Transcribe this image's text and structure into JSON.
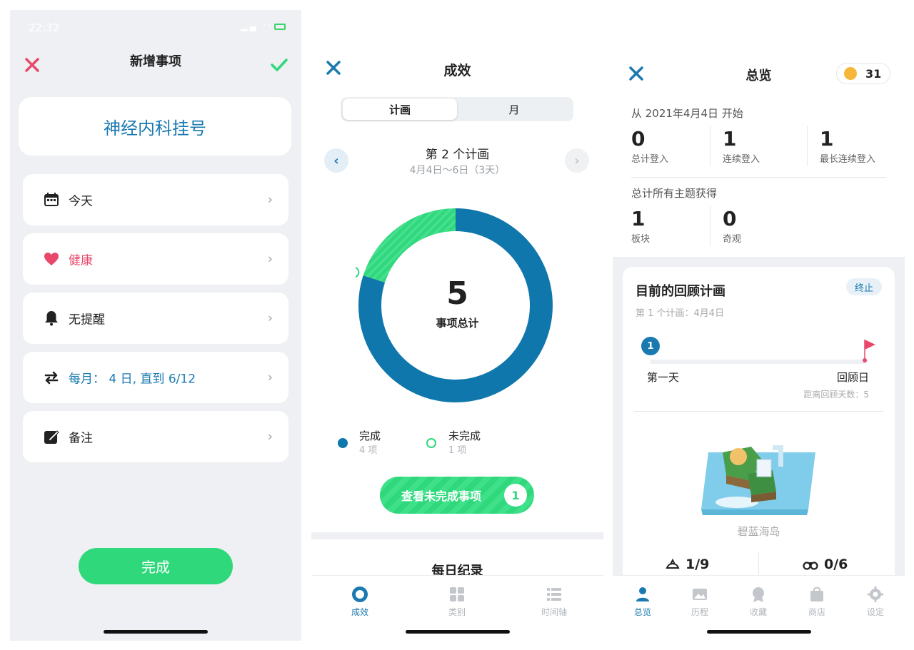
{
  "new_item": {
    "status_time": "22:32",
    "title": "新增事项",
    "name": "神经内科挂号",
    "rows": [
      {
        "label": "今天",
        "color": "#222222"
      },
      {
        "label": "健康",
        "color": "#e8486a"
      },
      {
        "label": "无提醒",
        "color": "#222222"
      },
      {
        "label": "每月： 4 日, 直到 6/12",
        "color": "#1a7ab0"
      },
      {
        "label": "备注",
        "color": "#222222"
      }
    ],
    "done_button": "完成"
  },
  "results": {
    "title": "成效",
    "segments": [
      "计画",
      "月"
    ],
    "plan_title": "第 2 个计画",
    "plan_range": "4月4日～6日（3天）",
    "total": "5",
    "total_label": "事项总计",
    "legend": [
      {
        "label": "完成",
        "sub": "4 项",
        "color": "#0f77ac"
      },
      {
        "label": "未完成",
        "sub": "1 项",
        "color": "#2fd87a"
      }
    ],
    "view_button": "查看未完成事项",
    "view_count": "1",
    "daily_title": "每日纪录",
    "tabs": [
      "成效",
      "类别",
      "时间轴"
    ]
  },
  "chart_data": {
    "type": "pie",
    "categories": [
      "完成",
      "未完成"
    ],
    "values": [
      4,
      1
    ],
    "colors": [
      "#0f77ac",
      "#2fd87a"
    ]
  },
  "overview": {
    "title": "总览",
    "coins": "31",
    "since": "从 2021年4月4日 开始",
    "login_stats": [
      {
        "value": "0",
        "label": "总计登入"
      },
      {
        "value": "1",
        "label": "连续登入"
      },
      {
        "value": "1",
        "label": "最长连续登入"
      }
    ],
    "themes_label": "总计所有主题获得",
    "theme_stats": [
      {
        "value": "1",
        "label": "板块"
      },
      {
        "value": "0",
        "label": "奇观"
      }
    ],
    "review": {
      "title": "目前的回顾计画",
      "stop": "终止",
      "subtitle": "第 1 个计画：4月4日",
      "pin": "1",
      "start_label": "第一天",
      "end_label": "回顾日",
      "distance": "距离回顾天数：5",
      "island": "碧蓝海岛",
      "stat_a": "1/9",
      "stat_b": "0/6"
    },
    "tabs": [
      "总览",
      "历程",
      "收藏",
      "商店",
      "设定"
    ]
  }
}
